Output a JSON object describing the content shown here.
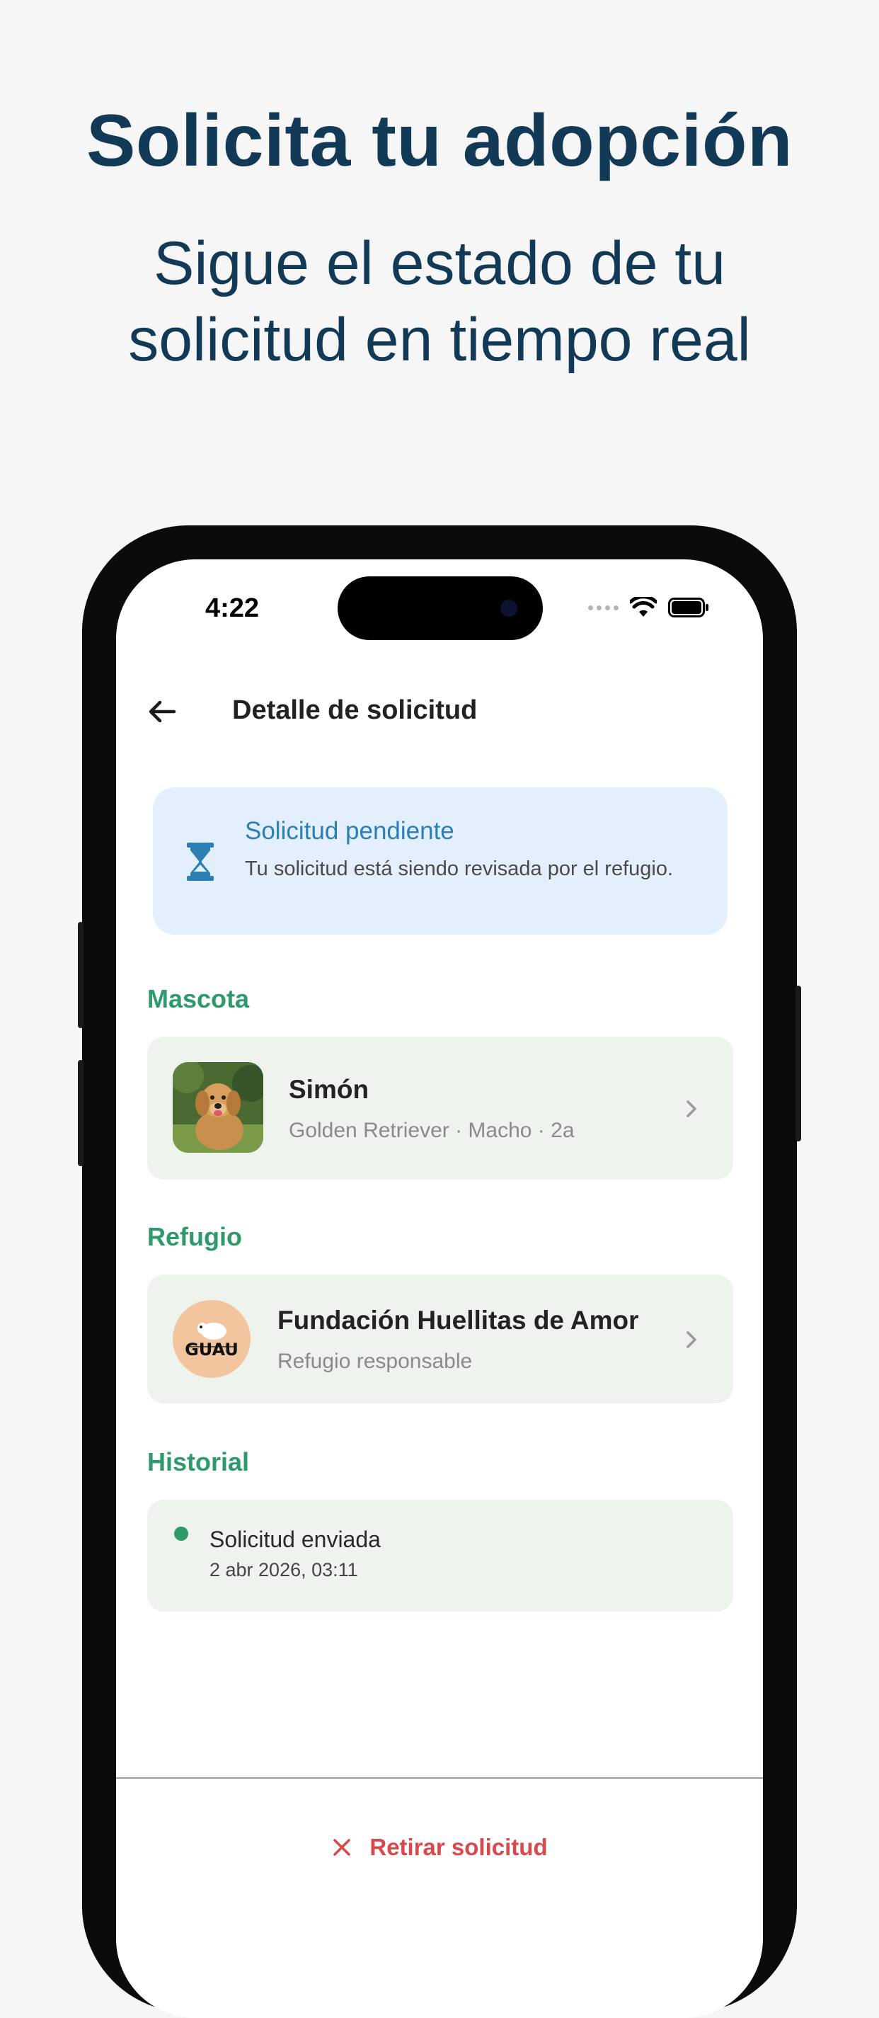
{
  "marketing": {
    "headline": "Solicita tu adopción",
    "subhead_line1": "Sigue el estado de tu",
    "subhead_line2": "solicitud en tiempo real"
  },
  "status_bar": {
    "time": "4:22"
  },
  "app_bar": {
    "title": "Detalle de solicitud",
    "back_icon": "arrow-left-icon"
  },
  "status_card": {
    "icon": "hourglass-icon",
    "title": "Solicitud pendiente",
    "description": "Tu solicitud está siendo revisada por el refugio."
  },
  "sections": {
    "pet": "Mascota",
    "shelter": "Refugio",
    "history": "Historial"
  },
  "pet": {
    "name": "Simón",
    "details": "Golden Retriever · Macho · 2a"
  },
  "shelter": {
    "name": "Fundación Huellitas de Amor",
    "role": "Refugio responsable",
    "logo_text": "GUAU"
  },
  "history": [
    {
      "title": "Solicitud enviada",
      "date": "2 abr 2026, 03:11"
    }
  ],
  "footer": {
    "withdraw_label": "Retirar solicitud"
  },
  "colors": {
    "headline": "#123a56",
    "accent_green": "#2e9a6b",
    "pending_blue": "#2b7fb5",
    "pending_bg": "#e3effd",
    "card_bg": "#eef3ed",
    "danger": "#d9484a"
  }
}
